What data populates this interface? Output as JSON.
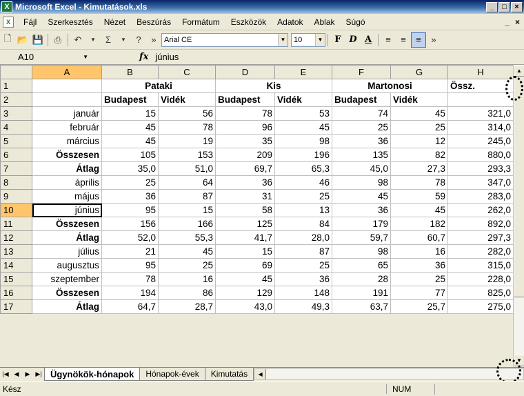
{
  "window": {
    "title": "Microsoft Excel - Kimutatások.xls",
    "app_icon": "excel-icon",
    "buttons": [
      "_",
      "□",
      "×"
    ]
  },
  "menu": {
    "items": [
      "Fájl",
      "Szerkesztés",
      "Nézet",
      "Beszúrás",
      "Formátum",
      "Eszközök",
      "Adatok",
      "Ablak",
      "Súgó"
    ],
    "right": [
      "_",
      "×"
    ]
  },
  "toolbar": {
    "font": "Arial CE",
    "size": "10",
    "bold": "F",
    "italic": "D",
    "underline": "A"
  },
  "formula": {
    "cell": "A10",
    "fx": "fx",
    "value": "június"
  },
  "columns": [
    "A",
    "B",
    "C",
    "D",
    "E",
    "F",
    "G",
    "H"
  ],
  "grid": {
    "row1": [
      "",
      "Pataki",
      "Kis",
      "Martonosi",
      "Össz."
    ],
    "row2": [
      "",
      "Budapest",
      "Vidék",
      "Budapest",
      "Vidék",
      "Budapest",
      "Vidék",
      ""
    ],
    "rows": [
      {
        "n": "3",
        "label": "január",
        "bold": false,
        "vals": [
          "15",
          "56",
          "78",
          "53",
          "74",
          "45",
          "321,0"
        ]
      },
      {
        "n": "4",
        "label": "február",
        "bold": false,
        "vals": [
          "45",
          "78",
          "96",
          "45",
          "25",
          "25",
          "314,0"
        ]
      },
      {
        "n": "5",
        "label": "március",
        "bold": false,
        "vals": [
          "45",
          "19",
          "35",
          "98",
          "36",
          "12",
          "245,0"
        ]
      },
      {
        "n": "6",
        "label": "Összesen",
        "bold": true,
        "vals": [
          "105",
          "153",
          "209",
          "196",
          "135",
          "82",
          "880,0"
        ]
      },
      {
        "n": "7",
        "label": "Átlag",
        "bold": true,
        "vals": [
          "35,0",
          "51,0",
          "69,7",
          "65,3",
          "45,0",
          "27,3",
          "293,3"
        ]
      },
      {
        "n": "8",
        "label": "április",
        "bold": false,
        "vals": [
          "25",
          "64",
          "36",
          "46",
          "98",
          "78",
          "347,0"
        ]
      },
      {
        "n": "9",
        "label": "május",
        "bold": false,
        "vals": [
          "36",
          "87",
          "31",
          "25",
          "45",
          "59",
          "283,0"
        ]
      },
      {
        "n": "10",
        "label": "június",
        "bold": false,
        "vals": [
          "95",
          "15",
          "58",
          "13",
          "36",
          "45",
          "262,0"
        ]
      },
      {
        "n": "11",
        "label": "Összesen",
        "bold": true,
        "vals": [
          "156",
          "166",
          "125",
          "84",
          "179",
          "182",
          "892,0"
        ]
      },
      {
        "n": "12",
        "label": "Átlag",
        "bold": true,
        "vals": [
          "52,0",
          "55,3",
          "41,7",
          "28,0",
          "59,7",
          "60,7",
          "297,3"
        ]
      },
      {
        "n": "13",
        "label": "július",
        "bold": false,
        "vals": [
          "21",
          "45",
          "15",
          "87",
          "98",
          "16",
          "282,0"
        ]
      },
      {
        "n": "14",
        "label": "augusztus",
        "bold": false,
        "vals": [
          "95",
          "25",
          "69",
          "25",
          "65",
          "36",
          "315,0"
        ]
      },
      {
        "n": "15",
        "label": "szeptember",
        "bold": false,
        "vals": [
          "78",
          "16",
          "45",
          "36",
          "28",
          "25",
          "228,0"
        ]
      },
      {
        "n": "16",
        "label": "Összesen",
        "bold": true,
        "vals": [
          "194",
          "86",
          "129",
          "148",
          "191",
          "77",
          "825,0"
        ]
      },
      {
        "n": "17",
        "label": "Átlag",
        "bold": true,
        "vals": [
          "64,7",
          "28,7",
          "43,0",
          "49,3",
          "63,7",
          "25,7",
          "275,0"
        ]
      }
    ]
  },
  "tabs": [
    "Ügynökök-hónapok",
    "Hónapok-évek",
    "Kimutatás"
  ],
  "status": {
    "ready": "Kész",
    "num": "NUM"
  }
}
